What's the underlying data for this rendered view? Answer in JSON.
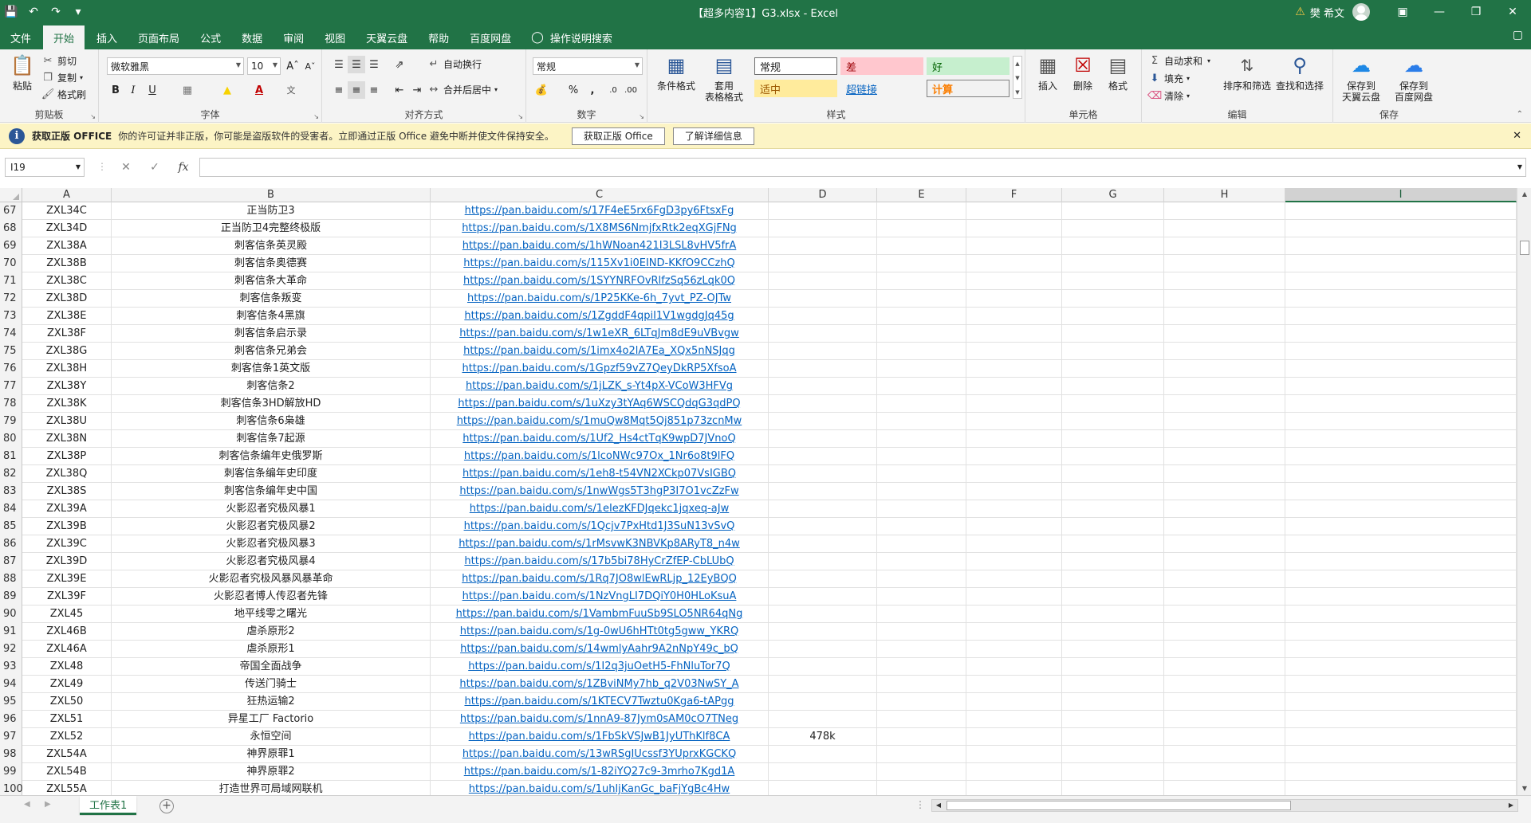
{
  "window": {
    "title": "【超多内容1】G3.xlsx  -  Excel",
    "user": "樊 希文",
    "warning_icon": "warning-icon"
  },
  "menu": {
    "tabs": [
      "文件",
      "开始",
      "插入",
      "页面布局",
      "公式",
      "数据",
      "审阅",
      "视图",
      "天翼云盘",
      "帮助",
      "百度网盘"
    ],
    "active": 1,
    "search_label": "操作说明搜索"
  },
  "ribbon": {
    "clipboard": {
      "paste": "粘贴",
      "cut": "剪切",
      "copy": "复制",
      "format_painter": "格式刷",
      "name": "剪贴板"
    },
    "font": {
      "family": "微软雅黑",
      "size": "10",
      "name": "字体"
    },
    "alignment": {
      "wrap": "自动换行",
      "merge": "合并后居中",
      "name": "对齐方式"
    },
    "number": {
      "format": "常规",
      "name": "数字"
    },
    "styles": {
      "conditional": "条件格式",
      "table_format_l1": "套用",
      "table_format_l2": "表格格式",
      "normal": "常规",
      "bad": "差",
      "good": "好",
      "neutral": "适中",
      "hyperlink": "超链接",
      "calc": "计算",
      "name": "样式"
    },
    "cells": {
      "insert": "插入",
      "delete": "删除",
      "format": "格式",
      "name": "单元格"
    },
    "editing": {
      "autosum": "自动求和",
      "fill": "填充",
      "clear": "清除",
      "sort": "排序和筛选",
      "find": "查找和选择",
      "name": "编辑"
    },
    "save": {
      "tianyi_l1": "保存到",
      "tianyi_l2": "天翼云盘",
      "baidu_l1": "保存到",
      "baidu_l2": "百度网盘",
      "name": "保存"
    },
    "colors": {
      "bad_bg": "#ffc7ce",
      "bad_fg": "#9c0006",
      "good_bg": "#c6efce",
      "good_fg": "#006100",
      "neutral_bg": "#ffeb9c",
      "neutral_fg": "#9c5700",
      "calc_bg": "#f2f2f2",
      "calc_fg": "#fa7d00"
    }
  },
  "notification": {
    "title": "获取正版 OFFICE",
    "message": "你的许可证并非正版，你可能是盗版软件的受害者。立即通过正版 Office 避免中断并使文件保持安全。",
    "button1": "获取正版 Office",
    "button2": "了解详细信息"
  },
  "formula_bar": {
    "name_box": "I19",
    "cancel": "✕",
    "enter": "✓",
    "fx": "fx",
    "value": ""
  },
  "columns": [
    "A",
    "B",
    "C",
    "D",
    "E",
    "F",
    "G",
    "H",
    "I"
  ],
  "selected_column": "I",
  "rows": [
    {
      "n": "67",
      "a": "ZXL34C",
      "b": "正当防卫3",
      "c": "https://pan.baidu.com/s/17F4eE5rx6FgD3py6FtsxFg",
      "d": ""
    },
    {
      "n": "68",
      "a": "ZXL34D",
      "b": "正当防卫4完整终极版",
      "c": "https://pan.baidu.com/s/1X8MS6NmjfxRtk2eqXGjFNg",
      "d": ""
    },
    {
      "n": "69",
      "a": "ZXL38A",
      "b": "刺客信条英灵殿",
      "c": "https://pan.baidu.com/s/1hWNoan421I3LSL8vHV5frA",
      "d": ""
    },
    {
      "n": "70",
      "a": "ZXL38B",
      "b": "刺客信条奥德赛",
      "c": "https://pan.baidu.com/s/115Xv1i0EIND-KKfO9CCzhQ",
      "d": ""
    },
    {
      "n": "71",
      "a": "ZXL38C",
      "b": "刺客信条大革命",
      "c": "https://pan.baidu.com/s/1SYYNRFOvRlfzSq56zLqk0Q",
      "d": ""
    },
    {
      "n": "72",
      "a": "ZXL38D",
      "b": "刺客信条叛变",
      "c": "https://pan.baidu.com/s/1P25KKe-6h_7yvt_PZ-OJTw",
      "d": ""
    },
    {
      "n": "73",
      "a": "ZXL38E",
      "b": "刺客信条4黑旗",
      "c": "https://pan.baidu.com/s/1ZgddF4qpiI1V1wgdgJq45g",
      "d": ""
    },
    {
      "n": "74",
      "a": "ZXL38F",
      "b": "刺客信条启示录",
      "c": "https://pan.baidu.com/s/1w1eXR_6LTqJm8dE9uVBvgw",
      "d": ""
    },
    {
      "n": "75",
      "a": "ZXL38G",
      "b": "刺客信条兄弟会",
      "c": "https://pan.baidu.com/s/1imx4o2lA7Ea_XQx5nNSJqg",
      "d": ""
    },
    {
      "n": "76",
      "a": "ZXL38H",
      "b": "刺客信条1英文版",
      "c": "https://pan.baidu.com/s/1Gpzf59vZ7QeyDkRP5XfsoA",
      "d": ""
    },
    {
      "n": "77",
      "a": "ZXL38Y",
      "b": "刺客信条2",
      "c": "https://pan.baidu.com/s/1jLZK_s-Yt4pX-VCoW3HFVg",
      "d": ""
    },
    {
      "n": "78",
      "a": "ZXL38K",
      "b": "刺客信条3HD解放HD",
      "c": "https://pan.baidu.com/s/1uXzy3tYAq6WSCQdqG3qdPQ",
      "d": ""
    },
    {
      "n": "79",
      "a": "ZXL38U",
      "b": "刺客信条6枭雄",
      "c": "https://pan.baidu.com/s/1muQw8Mqt5Qj851p73zcnMw",
      "d": ""
    },
    {
      "n": "80",
      "a": "ZXL38N",
      "b": "刺客信条7起源",
      "c": "https://pan.baidu.com/s/1Uf2_Hs4ctTqK9wpD7JVnoQ",
      "d": ""
    },
    {
      "n": "81",
      "a": "ZXL38P",
      "b": "刺客信条编年史俄罗斯",
      "c": "https://pan.baidu.com/s/1lcoNWc97Ox_1Nr6o8t9lFQ",
      "d": ""
    },
    {
      "n": "82",
      "a": "ZXL38Q",
      "b": "刺客信条编年史印度",
      "c": "https://pan.baidu.com/s/1eh8-t54VN2XCkp07VsIGBQ",
      "d": ""
    },
    {
      "n": "83",
      "a": "ZXL38S",
      "b": "刺客信条编年史中国",
      "c": "https://pan.baidu.com/s/1nwWgs5T3hgP3I7O1vcZzFw",
      "d": ""
    },
    {
      "n": "84",
      "a": "ZXL39A",
      "b": "火影忍者究极风暴1",
      "c": "https://pan.baidu.com/s/1eIezKFDJqekc1jqxeq-aJw",
      "d": ""
    },
    {
      "n": "85",
      "a": "ZXL39B",
      "b": "火影忍者究极风暴2",
      "c": "https://pan.baidu.com/s/1Qcjv7PxHtd1J3SuN13vSvQ",
      "d": ""
    },
    {
      "n": "86",
      "a": "ZXL39C",
      "b": "火影忍者究极风暴3",
      "c": "https://pan.baidu.com/s/1rMsvwK3NBVKp8ARyT8_n4w",
      "d": ""
    },
    {
      "n": "87",
      "a": "ZXL39D",
      "b": "火影忍者究极风暴4",
      "c": "https://pan.baidu.com/s/17b5bi78HyCrZfEP-CbLUbQ",
      "d": ""
    },
    {
      "n": "88",
      "a": "ZXL39E",
      "b": "火影忍者究极风暴风暴革命",
      "c": "https://pan.baidu.com/s/1Rq7JO8wlEwRLjp_12EyBQQ",
      "d": ""
    },
    {
      "n": "89",
      "a": "ZXL39F",
      "b": "火影忍者博人传忍者先锋",
      "c": "https://pan.baidu.com/s/1NzVngLI7DQiY0H0HLoKsuA",
      "d": ""
    },
    {
      "n": "90",
      "a": "ZXL45",
      "b": "地平线零之曙光",
      "c": "https://pan.baidu.com/s/1VambmFuuSb9SLO5NR64qNg",
      "d": ""
    },
    {
      "n": "91",
      "a": "ZXL46B",
      "b": "虐杀原形2",
      "c": "https://pan.baidu.com/s/1g-0wU6hHTt0tg5gww_YKRQ",
      "d": ""
    },
    {
      "n": "92",
      "a": "ZXL46A",
      "b": "虐杀原形1",
      "c": "https://pan.baidu.com/s/14wmlyAahr9A2nNpY49c_bQ",
      "d": ""
    },
    {
      "n": "93",
      "a": "ZXL48",
      "b": "帝国全面战争",
      "c": "https://pan.baidu.com/s/1I2q3juOetH5-FhNluTor7Q",
      "d": ""
    },
    {
      "n": "94",
      "a": "ZXL49",
      "b": "传送门骑士",
      "c": "https://pan.baidu.com/s/1ZBviNMy7hb_q2V03NwSY_A",
      "d": ""
    },
    {
      "n": "95",
      "a": "ZXL50",
      "b": "狂热运输2",
      "c": "https://pan.baidu.com/s/1KTECV7Twztu0Kga6-tAPgg",
      "d": ""
    },
    {
      "n": "96",
      "a": "ZXL51",
      "b": "异星工厂 Factorio",
      "c": "https://pan.baidu.com/s/1nnA9-87Jym0sAM0cO7TNeg",
      "d": ""
    },
    {
      "n": "97",
      "a": "ZXL52",
      "b": "永恒空间",
      "c": "https://pan.baidu.com/s/1FbSkVSJwB1JyUThKlf8CA",
      "d": "478k"
    },
    {
      "n": "98",
      "a": "ZXL54A",
      "b": "神界原罪1",
      "c": "https://pan.baidu.com/s/13wRSgIUcssf3YUprxKGCKQ",
      "d": ""
    },
    {
      "n": "99",
      "a": "ZXL54B",
      "b": "神界原罪2",
      "c": "https://pan.baidu.com/s/1-82iYQ27c9-3mrho7Kgd1A",
      "d": ""
    },
    {
      "n": "100",
      "a": "ZXL55A",
      "b": "打造世界可局域网联机",
      "c": "https://pan.baidu.com/s/1uhljKanGc_baFjYgBc4Hw",
      "d": ""
    }
  ],
  "sheets": {
    "active": "工作表1"
  }
}
